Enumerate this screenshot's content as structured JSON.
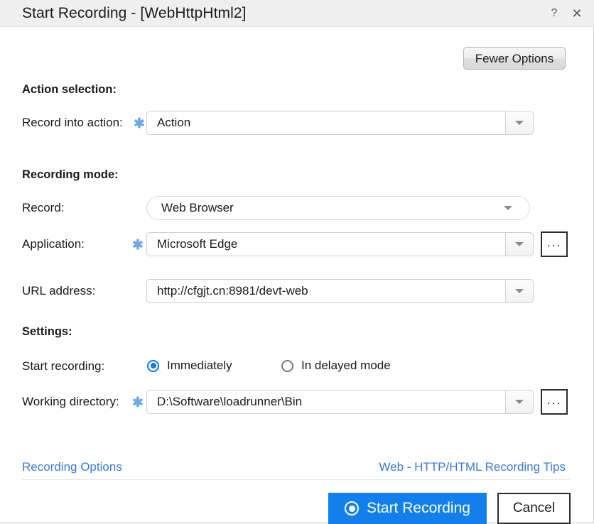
{
  "window": {
    "title": "Start Recording - [WebHttpHtml2]",
    "help_icon": "question-mark-icon",
    "close_icon": "close-icon"
  },
  "toolbar": {
    "fewer_options_label": "Fewer Options"
  },
  "sections": {
    "action_selection": {
      "heading": "Action selection:",
      "record_into_action": {
        "label": "Record into action:",
        "required_marker": "✱",
        "value": "Action"
      }
    },
    "recording_mode": {
      "heading": "Recording mode:",
      "record": {
        "label": "Record:",
        "value": "Web Browser"
      },
      "application": {
        "label": "Application:",
        "required_marker": "✱",
        "value": "Microsoft Edge",
        "browse_label": "..."
      },
      "url_address": {
        "label": "URL address:",
        "value": "http://cfgjt.cn:8981/devt-web"
      }
    },
    "settings": {
      "heading": "Settings:",
      "start_recording": {
        "label": "Start recording:",
        "options": [
          {
            "label": "Immediately",
            "selected": true
          },
          {
            "label": "In delayed mode",
            "selected": false
          }
        ]
      },
      "working_directory": {
        "label": "Working directory:",
        "required_marker": "✱",
        "value": "D:\\Software\\loadrunner\\Bin",
        "browse_label": "..."
      }
    }
  },
  "links": {
    "recording_options": "Recording Options",
    "recording_tips": "Web - HTTP/HTML Recording Tips"
  },
  "footer": {
    "start_label": "Start Recording",
    "cancel_label": "Cancel"
  },
  "colors": {
    "accent_blue": "#1280ec",
    "link_blue": "#3a7bd5",
    "required_star": "#6fa8e8",
    "titlebar_bg": "#efefef"
  }
}
